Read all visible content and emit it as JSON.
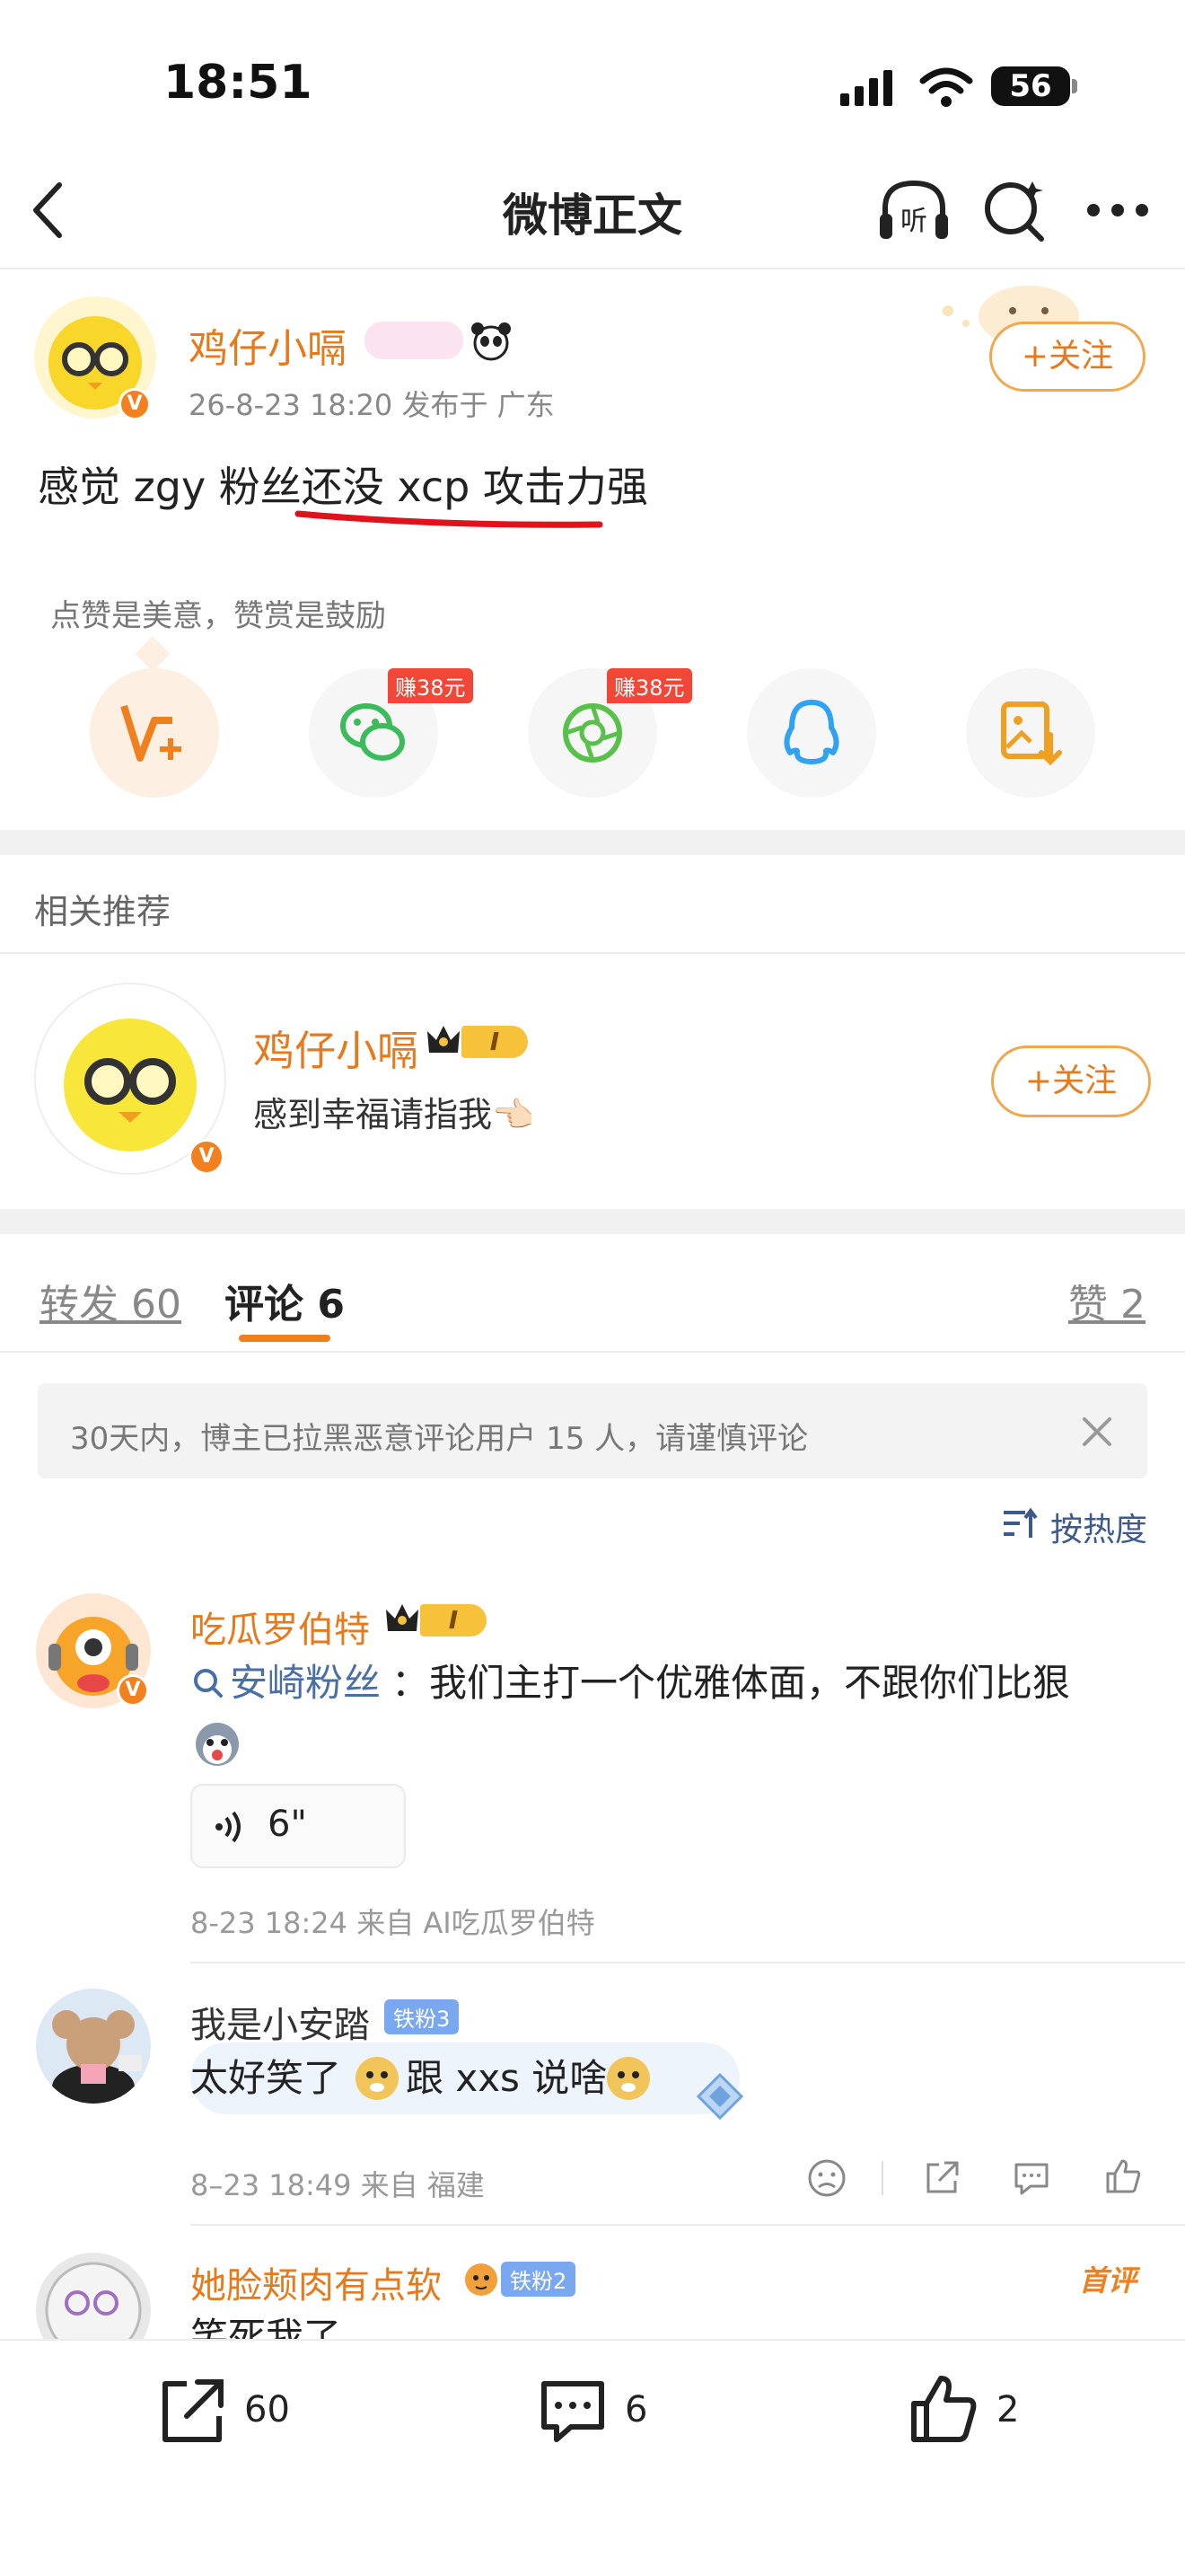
{
  "status_bar": {
    "time": "18:51",
    "battery": "56"
  },
  "nav": {
    "title": "微博正文"
  },
  "post": {
    "author": "鸡仔小嗝",
    "follow_label": "+关注",
    "meta": "26-8-23 18:20  发布于 广东",
    "text": "感觉 zgy 粉丝还没 xcp 攻击力强",
    "like_hint": "点赞是美意，赞赏是鼓励",
    "reward_tag_1": "赚38元",
    "reward_tag_2": "赚38元"
  },
  "related": {
    "heading": "相关推荐",
    "name": "鸡仔小嗝",
    "level_badge": "I",
    "bio": "感到幸福请指我👈🏻",
    "follow_label": "+关注"
  },
  "tabs": {
    "repost": "转发 60",
    "comment": "评论 6",
    "like": "赞 2"
  },
  "notice": {
    "text": "30天内，博主已拉黑恶意评论用户 15 人，请谨慎评论"
  },
  "sort": {
    "label": "按热度"
  },
  "comments": [
    {
      "name": "吃瓜罗伯特",
      "level_badge": "I",
      "topic": "安崎粉丝",
      "text": "：我们主打一个优雅体面，不跟你们比狠",
      "voice": "6\"",
      "meta": "8-23 18:24  来自 AI吃瓜罗伯特"
    },
    {
      "name": "我是小安踏",
      "fan_badge": "铁粉3",
      "text_a": "太好笑了",
      "text_b": "跟 xxs 说啥",
      "meta": "8–23 18:49  来自 福建"
    },
    {
      "name": "她脸颊肉有点软",
      "fan_badge": "铁粉2",
      "first_tag": "首评",
      "text": "笑死我了"
    }
  ],
  "bottom_bar": {
    "repost_count": "60",
    "comment_count": "6",
    "like_count": "2"
  },
  "colors": {
    "accent": "#e8791a",
    "divider": "#ececec",
    "gap": "#f1f1f1"
  }
}
